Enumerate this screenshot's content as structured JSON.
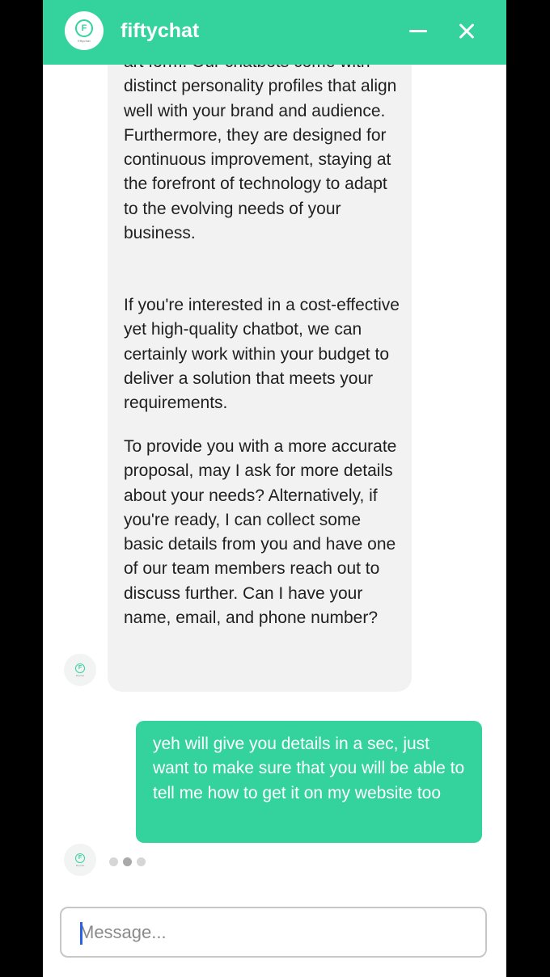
{
  "header": {
    "title": "fiftychat",
    "logo_letter": "F",
    "logo_caption": "fiftychat",
    "background": "#34d39e",
    "minimize_icon": "minimize-icon",
    "close_icon": "close-icon"
  },
  "messages": {
    "bot_message": {
      "paragraphs": [
        "art form. Our chatbots come with distinct personality profiles that align well with your brand and audience. Furthermore, they are designed for continuous improvement, staying at the forefront of technology to adapt to the evolving needs of your business.",
        "If you're interested in a cost-effective yet high-quality chatbot, we can certainly work within your budget to deliver a solution that meets your requirements.",
        "To provide you with a more accurate proposal, may I ask for more details about your needs? Alternatively, if you're ready, I can collect some basic details from you and have one of our team members reach out to discuss further. Can I have your name, email, and phone number?"
      ]
    },
    "user_message": "yeh will give you details in a sec, just want to make sure that you will be able to tell me how to get it on my website too",
    "avatar_letter": "F",
    "avatar_caption": "fiftychat"
  },
  "composer": {
    "placeholder": "Message..."
  },
  "colors": {
    "accent": "#34d39e",
    "bot_bubble": "#f2f2f2",
    "user_text": "#ffffff"
  }
}
